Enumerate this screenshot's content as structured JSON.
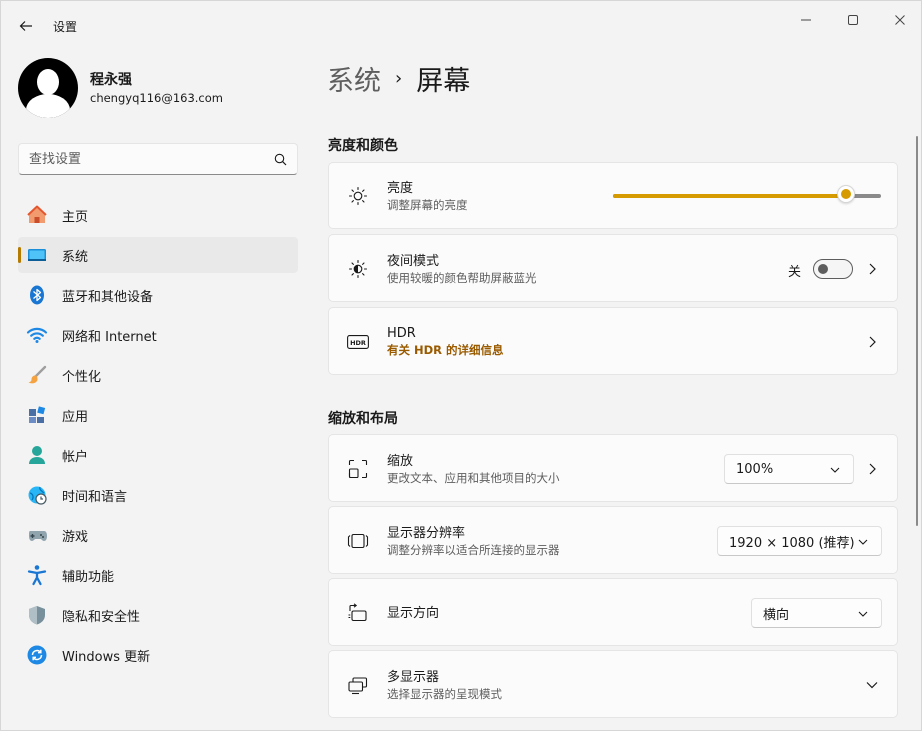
{
  "window": {
    "title": "设置"
  },
  "profile": {
    "name": "程永强",
    "email": "chengyq116@163.com"
  },
  "search": {
    "placeholder": "查找设置"
  },
  "sidebar": {
    "items": [
      {
        "label": "主页",
        "icon": "home-icon"
      },
      {
        "label": "系统",
        "icon": "system-icon",
        "active": true
      },
      {
        "label": "蓝牙和其他设备",
        "icon": "bluetooth-icon"
      },
      {
        "label": "网络和 Internet",
        "icon": "wifi-icon"
      },
      {
        "label": "个性化",
        "icon": "brush-icon"
      },
      {
        "label": "应用",
        "icon": "apps-icon"
      },
      {
        "label": "帐户",
        "icon": "account-icon"
      },
      {
        "label": "时间和语言",
        "icon": "globe-clock-icon"
      },
      {
        "label": "游戏",
        "icon": "gamepad-icon"
      },
      {
        "label": "辅助功能",
        "icon": "accessibility-icon"
      },
      {
        "label": "隐私和安全性",
        "icon": "shield-icon"
      },
      {
        "label": "Windows 更新",
        "icon": "update-icon"
      }
    ]
  },
  "breadcrumb": {
    "parent": "系统",
    "separator": "›",
    "current": "屏幕"
  },
  "sections": {
    "brightness_color": "亮度和颜色",
    "scale_layout": "缩放和布局"
  },
  "brightness": {
    "title": "亮度",
    "subtitle": "调整屏幕的亮度",
    "value_fraction": 0.87
  },
  "night_light": {
    "title": "夜间模式",
    "subtitle": "使用较暖的颜色帮助屏蔽蓝光",
    "state_label": "关"
  },
  "hdr": {
    "title": "HDR",
    "link": "有关 HDR 的详细信息"
  },
  "scale": {
    "title": "缩放",
    "subtitle": "更改文本、应用和其他项目的大小",
    "value": "100%"
  },
  "resolution": {
    "title": "显示器分辨率",
    "subtitle": "调整分辨率以适合所连接的显示器",
    "value": "1920 × 1080 (推荐)"
  },
  "orientation": {
    "title": "显示方向",
    "value": "横向"
  },
  "multi_display": {
    "title": "多显示器",
    "subtitle": "选择显示器的呈现模式"
  },
  "colors": {
    "accent": "#d69b00",
    "active_indicator": "#b57a00",
    "link": "#9a5b00"
  }
}
